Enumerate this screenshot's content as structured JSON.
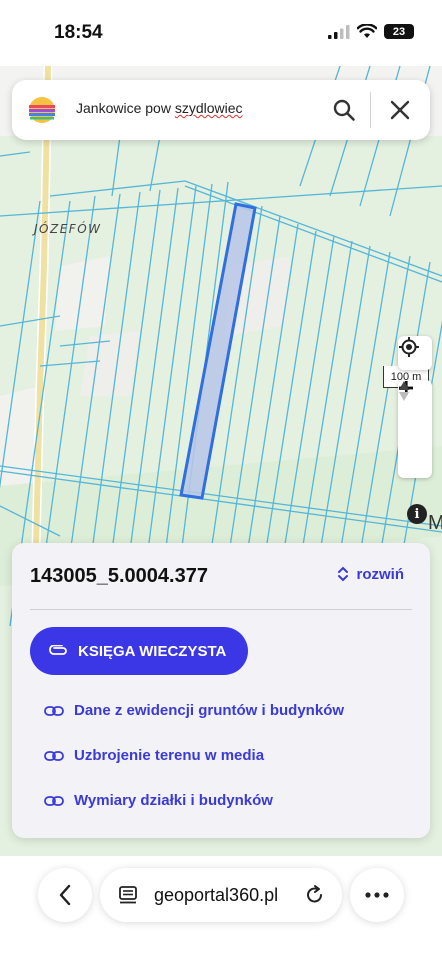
{
  "status_bar": {
    "time": "18:54",
    "battery": "23"
  },
  "search": {
    "query_prefix": "Jankowice pow ",
    "query_underlined": "szydlowiec"
  },
  "map": {
    "place_label": "JÓZEFÓW",
    "scale_label": "100 m",
    "edge_label": "M"
  },
  "parcel": {
    "id": "143005_5.0004.377",
    "expand_label": "rozwiń",
    "primary_button": "KSIĘGA WIECZYSTA",
    "links": [
      "Dane z ewidencji gruntów i budynków",
      "Uzbrojenie terenu w media",
      "Wymiary działki i budynków"
    ]
  },
  "browser": {
    "url": "geoportal360.pl"
  },
  "colors": {
    "accent": "#3b37e6",
    "link": "#3a3ad8",
    "parcel_outline": "#2f6fe0",
    "map_lines": "#55b6d8"
  }
}
